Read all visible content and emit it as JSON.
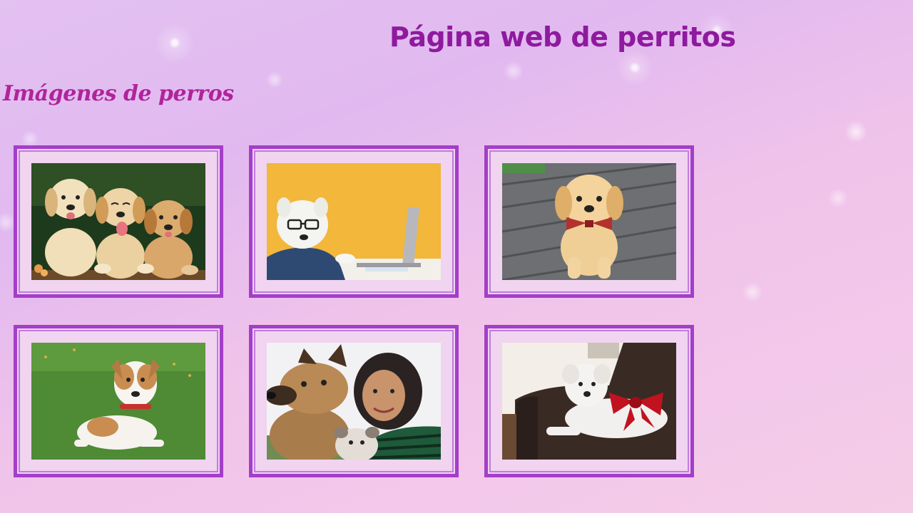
{
  "header": {
    "title": "Página web de perritos"
  },
  "section": {
    "title": "Imágenes de perros"
  },
  "gallery": {
    "images": [
      {
        "name": "three-golden-puppies-photo"
      },
      {
        "name": "westie-with-glasses-laptop-photo"
      },
      {
        "name": "golden-puppy-bowtie-photo"
      },
      {
        "name": "jack-russell-puppy-grass-photo"
      },
      {
        "name": "woman-with-dogs-selfie-photo"
      },
      {
        "name": "white-dog-red-bow-sofa-photo"
      }
    ]
  },
  "colors": {
    "title": "#8e1a9e",
    "section_title": "#b0249b",
    "frame_border": "#a43ec9",
    "frame_fill": "#f0d4f0"
  }
}
